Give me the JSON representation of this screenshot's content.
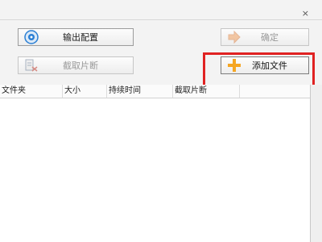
{
  "window": {
    "close_glyph": "×"
  },
  "buttons": {
    "output_settings": {
      "label": "输出配置",
      "icon": "disc-icon",
      "enabled": true
    },
    "clip": {
      "label": "截取片断",
      "icon": "clip-icon",
      "enabled": false
    },
    "confirm": {
      "label": "确定",
      "icon": "arrow-right-icon",
      "enabled": false
    },
    "add_file": {
      "label": "添加文件",
      "icon": "plus-icon",
      "enabled": true
    }
  },
  "table": {
    "columns": [
      "文件夹",
      "大小",
      "持续时间",
      "截取片断",
      ""
    ],
    "rows": []
  },
  "colors": {
    "highlight": "#e02222",
    "plus": "#f5a623",
    "disc": "#2a7fd4"
  }
}
